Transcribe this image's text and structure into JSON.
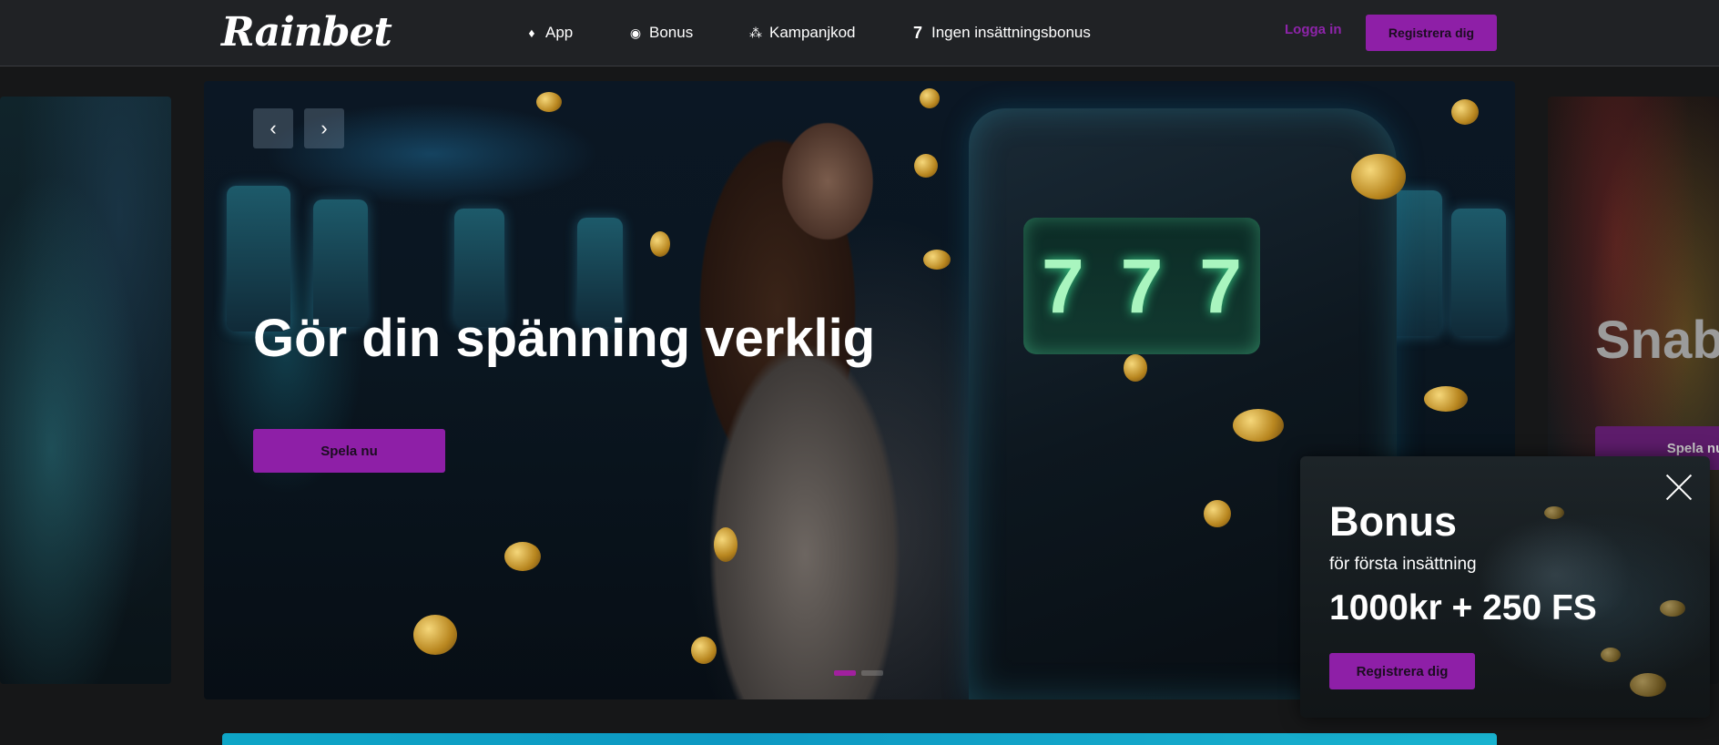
{
  "header": {
    "logo": "Rainbet",
    "nav": [
      {
        "label": "App",
        "icon": "diamond-icon"
      },
      {
        "label": "Bonus",
        "icon": "coin-icon"
      },
      {
        "label": "Kampanjkod",
        "icon": "nodes-icon"
      },
      {
        "label": "Ingen insättningsbonus",
        "icon": "seven-icon"
      }
    ],
    "login_label": "Logga in",
    "register_label": "Registrera dig"
  },
  "carousel": {
    "slide_title": "Gör din spänning verklig",
    "play_label": "Spela nu",
    "prev_icon": "‹",
    "next_icon": "›",
    "next_slide_title": "Snabbt och enkelt",
    "next_slide_button": "Spela nu",
    "reel_symbols": [
      "7",
      "7",
      "7"
    ],
    "active_dot": 0,
    "dot_count": 2
  },
  "popup": {
    "title": "Bonus",
    "subtitle": "för första insättning",
    "amount": "1000kr + 250 FS",
    "button_label": "Registrera dig"
  },
  "colors": {
    "accent": "#8e1fa7",
    "header_bg": "#202225",
    "page_bg": "#161718",
    "banner": "#0ea5c6"
  }
}
